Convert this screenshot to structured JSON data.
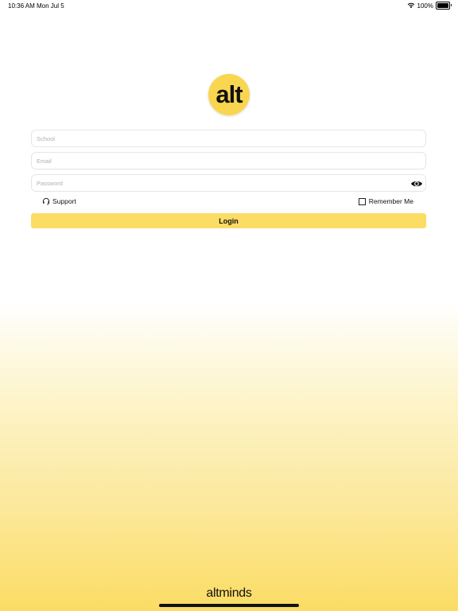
{
  "status_bar": {
    "time": "10:36 AM",
    "date": "Mon Jul 5",
    "battery": "100%"
  },
  "logo": {
    "text": "alt"
  },
  "form": {
    "school_placeholder": "School",
    "email_placeholder": "Email",
    "password_placeholder": "Password",
    "support_label": "Support",
    "remember_label": "Remember Me",
    "login_label": "Login"
  },
  "footer": {
    "brand": "altminds"
  },
  "colors": {
    "accent": "#fbdc64",
    "logo": "#f9d64f"
  },
  "icons": {
    "wifi": "wifi-icon",
    "battery": "battery-icon",
    "eye": "eye-icon",
    "support": "headset-icon"
  }
}
